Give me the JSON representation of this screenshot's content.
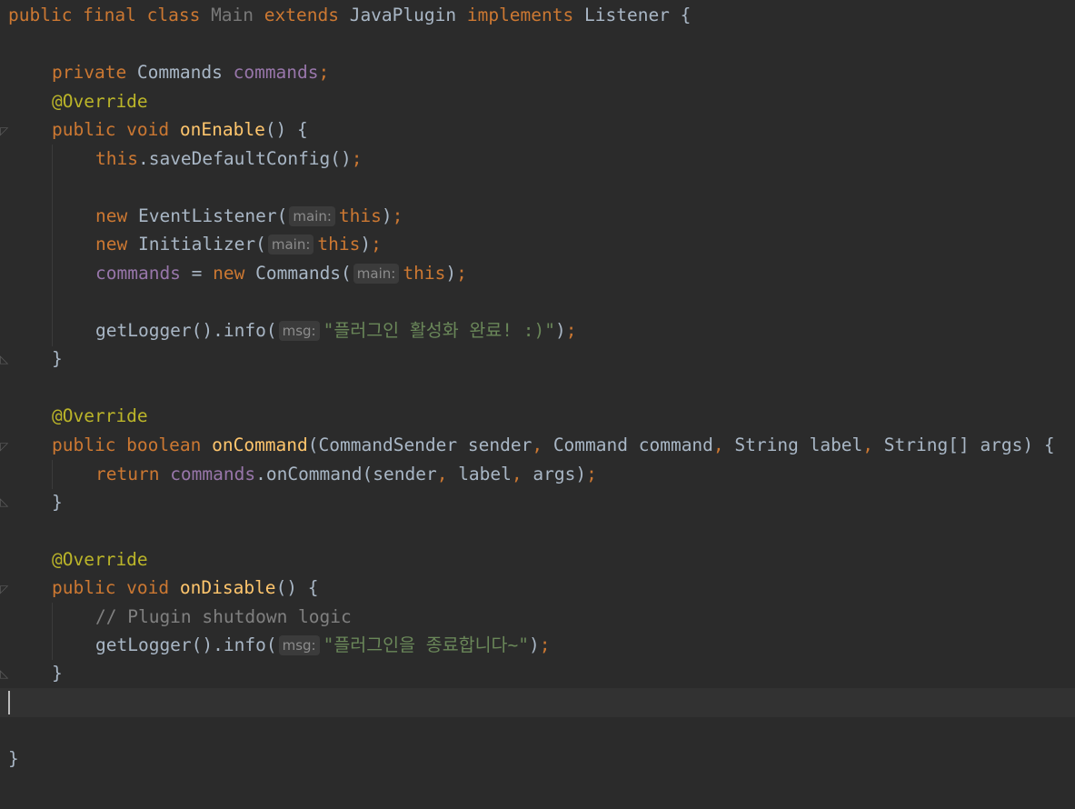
{
  "code": {
    "class_decl": {
      "kw1": "public final class ",
      "name": "Main",
      "kw2": " extends ",
      "parent": "JavaPlugin",
      "kw3": " implements ",
      "iface": "Listener",
      "brace": " {"
    },
    "field": {
      "kw": "private ",
      "type": "Commands ",
      "name": "commands",
      "semi": ";"
    },
    "override1": "@Override",
    "on_enable_sig": {
      "kw": "public void ",
      "name": "onEnable",
      "rest": "() {"
    },
    "save_config": {
      "kw": "this",
      "call": ".saveDefaultConfig()",
      "semi": ";"
    },
    "event_listener": {
      "kw": "new ",
      "call": "EventListener(",
      "hint": "main:",
      "arg": "this",
      "close": ")",
      "semi": ";"
    },
    "initializer": {
      "kw": "new ",
      "call": "Initializer(",
      "hint": "main:",
      "arg": "this",
      "close": ")",
      "semi": ";"
    },
    "commands_assign": {
      "field": "commands",
      "eq": " = ",
      "kw": "new ",
      "call": "Commands(",
      "hint": "main:",
      "arg": "this",
      "close": ")",
      "semi": ";"
    },
    "log_enable": {
      "call": "getLogger().info(",
      "hint": "msg:",
      "str": "\"플러그인 활성화 완료! :)\"",
      "close": ")",
      "semi": ";"
    },
    "close_brace": "}",
    "override2": "@Override",
    "on_command_sig": {
      "kw": "public boolean ",
      "name": "onCommand",
      "p1": "(CommandSender sender",
      "c1": ", ",
      "p2": "Command command",
      "c2": ", ",
      "p3": "String label",
      "c3": ", ",
      "p4": "String[] args) {"
    },
    "return_line": {
      "kw": "return ",
      "field": "commands",
      "call": ".onCommand(sender",
      "c1": ", ",
      "a2": "label",
      "c2": ", ",
      "a3": "args)",
      "semi": ";"
    },
    "override3": "@Override",
    "on_disable_sig": {
      "kw": "public void ",
      "name": "onDisable",
      "rest": "() {"
    },
    "comment": "// Plugin shutdown logic",
    "log_disable": {
      "call": "getLogger().info(",
      "hint": "msg:",
      "str": "\"플러그인을 종료합니다~\"",
      "close": ")",
      "semi": ";"
    },
    "class_close": "}"
  },
  "colors": {
    "background": "#2b2b2b",
    "keyword": "#cc7832",
    "field": "#9876aa",
    "annotation": "#bbb529",
    "method": "#ffc66d",
    "string": "#6a8759",
    "comment": "#808080",
    "text": "#a9b7c6"
  }
}
